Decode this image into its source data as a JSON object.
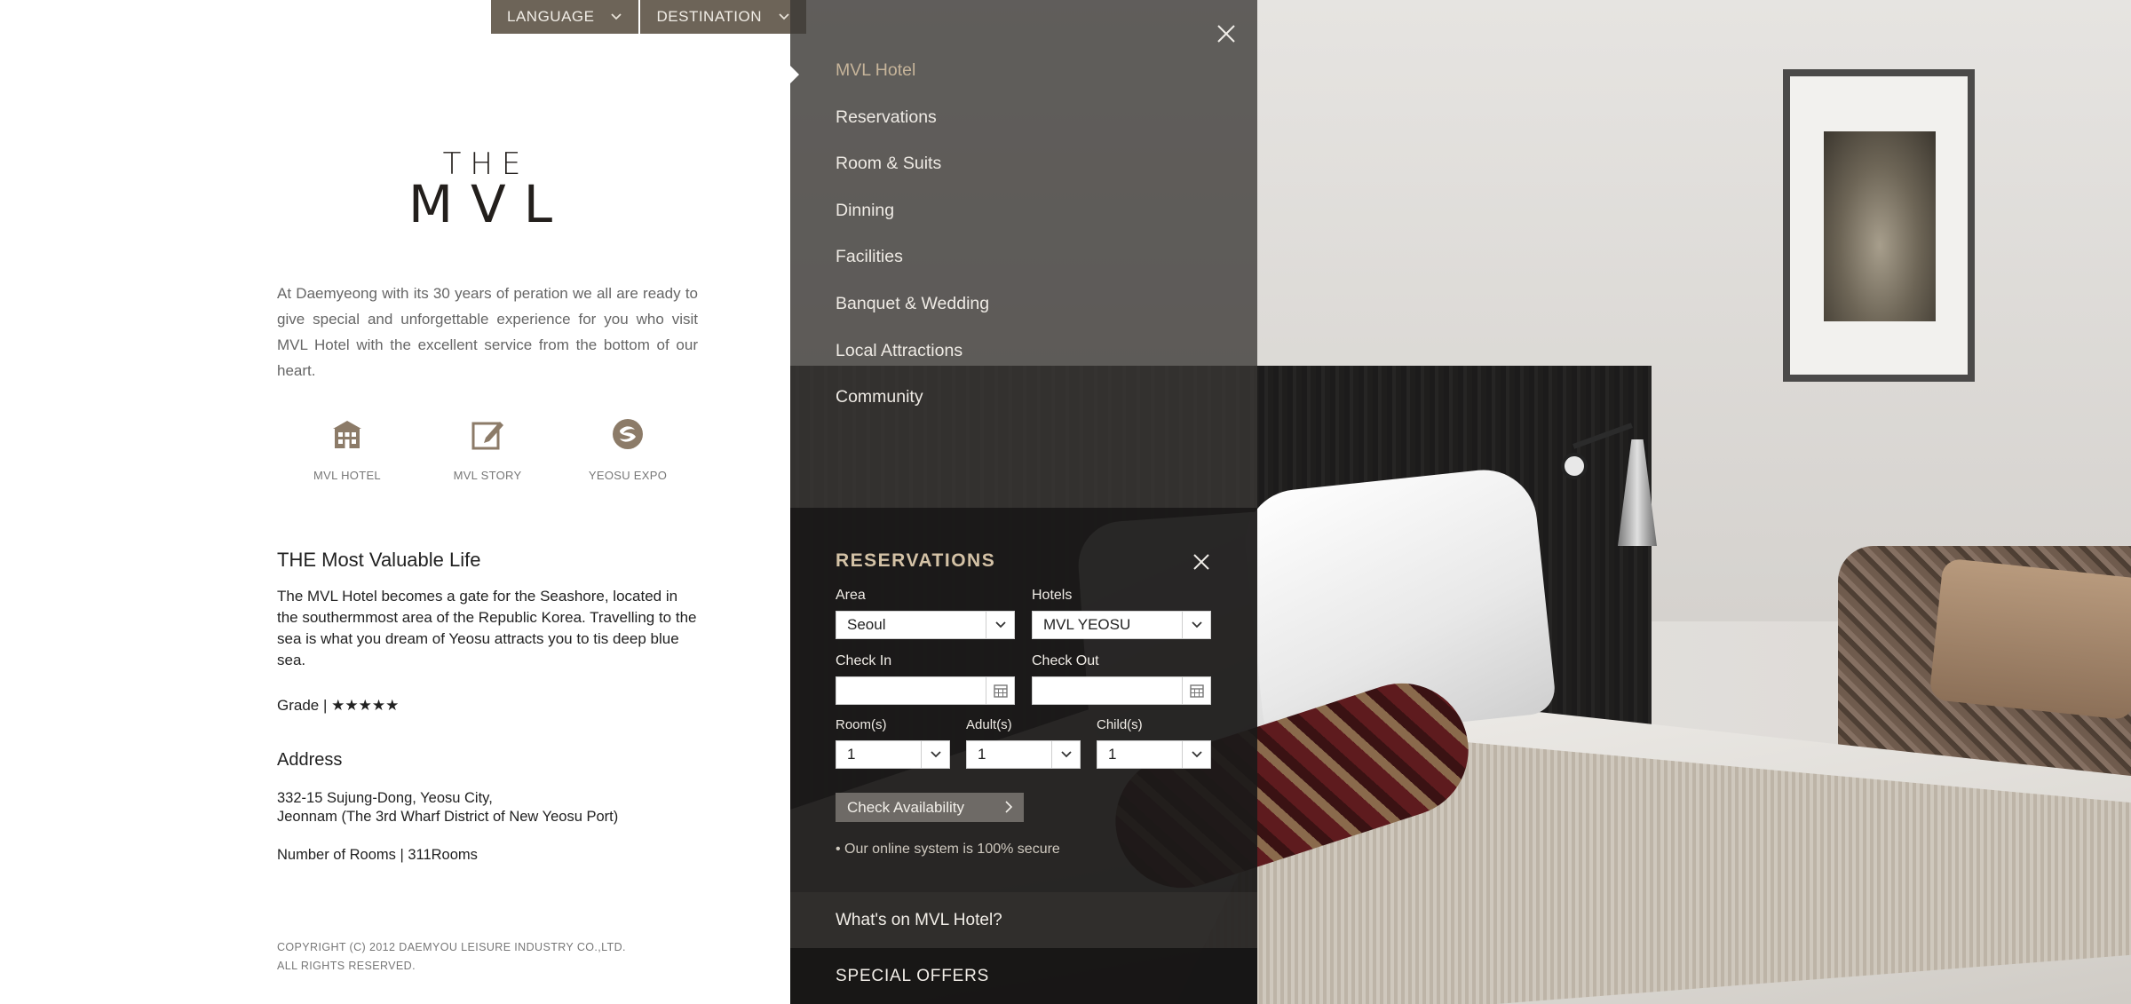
{
  "topbar": {
    "language": "LANGUAGE",
    "destination": "DESTINATION"
  },
  "logo": {
    "line1": "THE",
    "line2": "MVL"
  },
  "intro": "At Daemyeong with its 30 years of peration we all are ready to give special and unforgettable experience for you who visit MVL Hotel with the  excellent service from the bottom of our heart.",
  "quicklinks": [
    {
      "label": "MVL HOTEL",
      "icon": "hotel-building-icon"
    },
    {
      "label": "MVL STORY",
      "icon": "edit-note-icon"
    },
    {
      "label": "YEOSU EXPO",
      "icon": "expo-emblem-icon"
    }
  ],
  "about": {
    "heading": "THE Most Valuable Life",
    "text": "The MVL Hotel becomes a gate for the Seashore, located in the southermmost area of the Republic Korea. Travelling to the sea is what you dream of Yeosu attracts you to tis deep blue sea.",
    "grade": "Grade | ★★★★★"
  },
  "address": {
    "heading": "Address",
    "line1": "332-15 Sujung-Dong, Yeosu City,",
    "line2": "Jeonnam (The 3rd Wharf District of New Yeosu Port)",
    "rooms": "Number of Rooms | 311Rooms"
  },
  "copyright": {
    "line1": "COPYRIGHT (C) 2012 DAEMYOU LEISURE INDUSTRY CO.,LTD.",
    "line2": "ALL RIGHTS RESERVED."
  },
  "menu": {
    "items": [
      "MVL Hotel",
      "Reservations",
      "Room & Suits",
      "Dinning",
      "Facilities",
      "Banquet & Wedding",
      "Local Attractions",
      "Community"
    ],
    "active_index": 0
  },
  "reservations": {
    "title": "RESERVATIONS",
    "area_label": "Area",
    "area_value": "Seoul",
    "hotels_label": "Hotels",
    "hotels_value": "MVL YEOSU",
    "checkin_label": "Check In",
    "checkout_label": "Check Out",
    "rooms_label": "Room(s)",
    "rooms_value": "1",
    "adults_label": "Adult(s)",
    "adults_value": "1",
    "children_label": "Child(s)",
    "children_value": "1",
    "check_button": "Check Availability",
    "secure_note": "• Our online system is 100% secure"
  },
  "bottom": {
    "whats_on": "What's on MVL Hotel?",
    "special_offers": "SPECIAL OFFERS"
  },
  "colors": {
    "accent": "#6d6458",
    "active_menu": "#c6b49a",
    "reservation_title": "#d4c2a6"
  }
}
